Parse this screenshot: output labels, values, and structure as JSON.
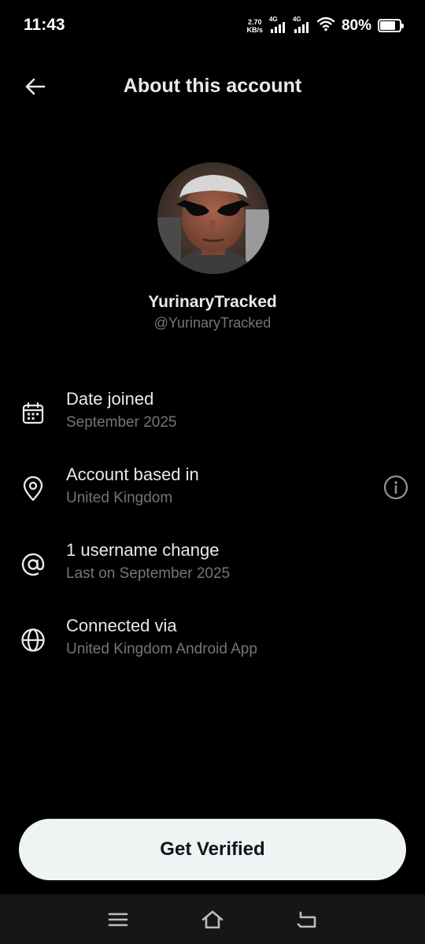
{
  "status_bar": {
    "time": "11:43",
    "net_speed_value": "2.70",
    "net_speed_unit": "KB/s",
    "signal_1_label": "4G",
    "signal_2_label": "4G",
    "battery_percent": "80%",
    "battery_level": 0.8
  },
  "header": {
    "title": "About this account",
    "back_icon": "arrow-left-icon"
  },
  "profile": {
    "display_name": "YurinaryTracked",
    "handle": "@YurinaryTracked"
  },
  "details": [
    {
      "icon": "calendar-icon",
      "title": "Date joined",
      "subtitle": "September 2025"
    },
    {
      "icon": "location-pin-icon",
      "title": "Account based in",
      "subtitle": "United Kingdom"
    },
    {
      "icon": "at-sign-icon",
      "title": "1 username change",
      "subtitle": "Last on September 2025"
    },
    {
      "icon": "globe-icon",
      "title": "Connected via",
      "subtitle": "United Kingdom Android App"
    }
  ],
  "cta": {
    "label": "Get Verified"
  },
  "nav": {
    "menu_icon": "menu-icon",
    "home_icon": "home-icon",
    "back_icon": "back-icon"
  },
  "colors": {
    "background": "#000000",
    "primary_text": "#e7e9ea",
    "secondary_text": "#71767b",
    "button_bg": "#eff3f4",
    "button_text": "#0f1419"
  }
}
